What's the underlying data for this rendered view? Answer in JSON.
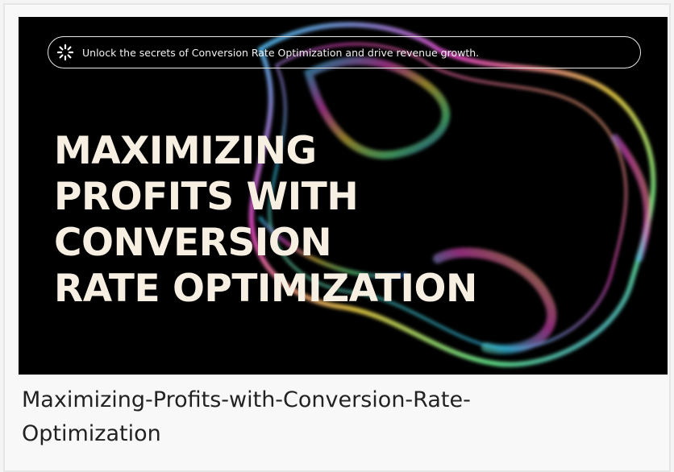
{
  "banner": {
    "tagline": "Unlock the secrets of Conversion Rate Optimization and drive revenue growth.",
    "tagline_icon": "sparkle-burst-icon",
    "headline_lines": [
      "MAXIMIZING",
      "PROFITS WITH",
      "CONVERSION",
      "RATE OPTIMIZATION"
    ],
    "colors": {
      "background": "#000000",
      "headline": "#f6efe2",
      "bubble_cyan": "#39d7ff",
      "bubble_magenta": "#ff4fd8",
      "bubble_yellow": "#ffe14a"
    }
  },
  "caption": {
    "lines": [
      "Maximizing-Profits-with-Conversion-Rate-",
      "Optimization"
    ]
  }
}
